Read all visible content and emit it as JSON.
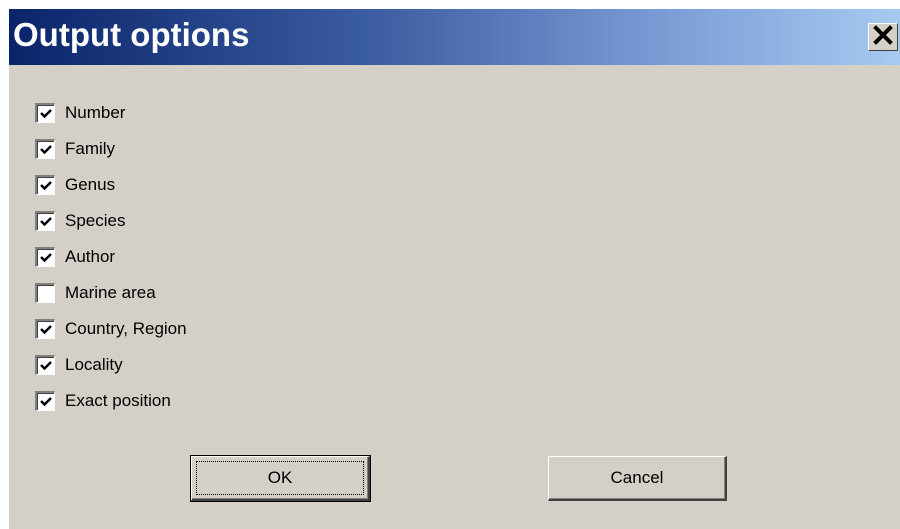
{
  "dialog": {
    "title": "Output options"
  },
  "options": [
    {
      "label": "Number",
      "checked": true
    },
    {
      "label": "Family",
      "checked": true
    },
    {
      "label": "Genus",
      "checked": true
    },
    {
      "label": "Species",
      "checked": true
    },
    {
      "label": "Author",
      "checked": true
    },
    {
      "label": "Marine area",
      "checked": false
    },
    {
      "label": "Country, Region",
      "checked": true
    },
    {
      "label": "Locality",
      "checked": true
    },
    {
      "label": "Exact position",
      "checked": true
    }
  ],
  "buttons": {
    "ok_label": "OK",
    "cancel_label": "Cancel"
  },
  "colors": {
    "title_bar_start": "#0a246a",
    "title_bar_end": "#a6caf0",
    "dialog_bg": "#d4d0c8"
  },
  "icons": {
    "close": "close-icon",
    "check": "checkmark-icon"
  }
}
